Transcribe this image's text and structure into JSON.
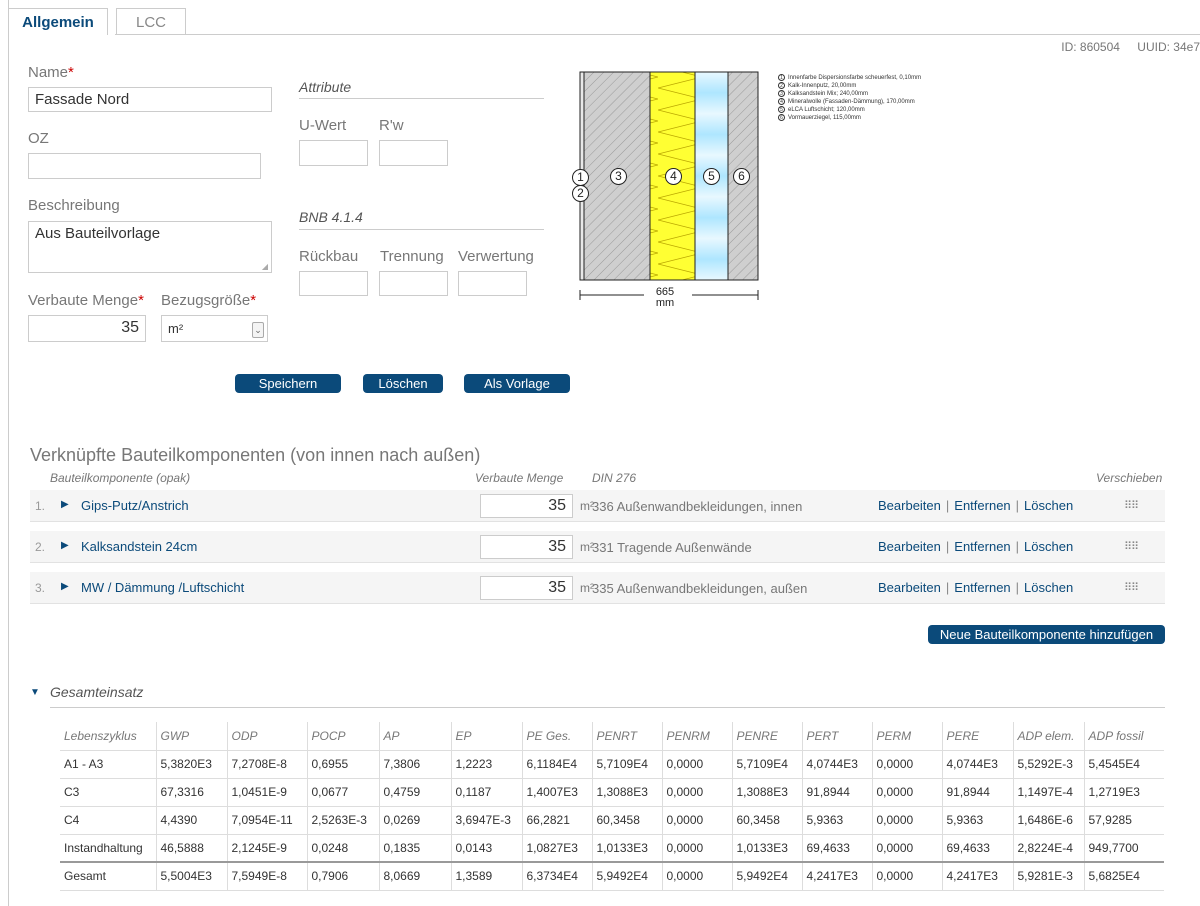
{
  "tabs": [
    {
      "label": "Allgemein"
    },
    {
      "label": "LCC"
    }
  ],
  "meta": {
    "id_text": "ID: 860504",
    "uuid_text": "UUID: 34e7"
  },
  "form": {
    "name_label": "Name",
    "name_value": "Fassade Nord",
    "oz_label": "OZ",
    "oz_value": "",
    "beschreibung_label": "Beschreibung",
    "beschreibung_value": "Aus Bauteilvorlage",
    "menge_label": "Verbaute Menge",
    "menge_value": "35",
    "bezug_label": "Bezugsgröße",
    "bezug_value": "m²",
    "required_mark": "*"
  },
  "attribute": {
    "title": "Attribute",
    "uwert_label": "U-Wert",
    "rw_label": "R'w",
    "uwert_value": "",
    "rw_value": ""
  },
  "bnb": {
    "title": "BNB 4.1.4",
    "rueckbau_label": "Rückbau",
    "trennung_label": "Trennung",
    "verwertung_label": "Verwertung"
  },
  "diagram": {
    "dimension_value": "665",
    "dimension_unit": "mm",
    "layer_numbers": [
      "1",
      "2",
      "3",
      "4",
      "5",
      "6"
    ],
    "colors": {
      "plaster": "#d0d0d0",
      "brick": "#c8c8c8",
      "insulation": "#ffff33",
      "air": "#cdeeff"
    },
    "legend": [
      "Innenfarbe Dispersionsfarbe scheuerfest, 0,10mm",
      "Kalk-Innenputz, 20,00mm",
      "Kalksandstein Mix; 240,00mm",
      "Mineralwolle (Fassaden-Dämmung), 170,00mm",
      "eLCA Luftschicht; 120,00mm",
      "Vormauerziegel, 115,00mm"
    ]
  },
  "buttons": {
    "save": "Speichern",
    "delete": "Löschen",
    "template": "Als Vorlage",
    "add_component": "Neue Bauteilkomponente hinzufügen"
  },
  "components": {
    "title": "Verknüpfte Bauteilkomponenten (von innen nach außen)",
    "col_component": "Bauteilkomponente (opak)",
    "col_qty": "Verbaute Menge",
    "col_din": "DIN 276",
    "col_move": "Verschieben",
    "action_edit": "Bearbeiten",
    "action_remove": "Entfernen",
    "action_delete": "Löschen",
    "rows": [
      {
        "idx": "1.",
        "name": "Gips-Putz/Anstrich",
        "qty": "35",
        "unit": "m²",
        "din": "336 Außenwandbekleidungen, innen"
      },
      {
        "idx": "2.",
        "name": "Kalksandstein 24cm",
        "qty": "35",
        "unit": "m²",
        "din": "331 Tragende Außenwände"
      },
      {
        "idx": "3.",
        "name": "MW / Dämmung /Luftschicht",
        "qty": "35",
        "unit": "m²",
        "din": "335 Außenwandbekleidungen, außen"
      }
    ]
  },
  "results": {
    "title": "Gesamteinsatz",
    "headers": [
      "Lebenszyklus",
      "GWP",
      "ODP",
      "POCP",
      "AP",
      "EP",
      "PE Ges.",
      "PENRT",
      "PENRM",
      "PENRE",
      "PERT",
      "PERM",
      "PERE",
      "ADP elem.",
      "ADP fossil"
    ],
    "rows": [
      [
        "A1 - A3",
        "5,3820E3",
        "7,2708E-8",
        "0,6955",
        "7,3806",
        "1,2223",
        "6,1184E4",
        "5,7109E4",
        "0,0000",
        "5,7109E4",
        "4,0744E3",
        "0,0000",
        "4,0744E3",
        "5,5292E-3",
        "5,4545E4"
      ],
      [
        "C3",
        "67,3316",
        "1,0451E-9",
        "0,0677",
        "0,4759",
        "0,1187",
        "1,4007E3",
        "1,3088E3",
        "0,0000",
        "1,3088E3",
        "91,8944",
        "0,0000",
        "91,8944",
        "1,1497E-4",
        "1,2719E3"
      ],
      [
        "C4",
        "4,4390",
        "7,0954E-11",
        "2,5263E-3",
        "0,0269",
        "3,6947E-3",
        "66,2821",
        "60,3458",
        "0,0000",
        "60,3458",
        "5,9363",
        "0,0000",
        "5,9363",
        "1,6486E-6",
        "57,9285"
      ],
      [
        "Instandhaltung",
        "46,5888",
        "2,1245E-9",
        "0,0248",
        "0,1835",
        "0,0143",
        "1,0827E3",
        "1,0133E3",
        "0,0000",
        "1,0133E3",
        "69,4633",
        "0,0000",
        "69,4633",
        "2,8224E-4",
        "949,7700"
      ],
      [
        "Gesamt",
        "5,5004E3",
        "7,5949E-8",
        "0,7906",
        "8,0669",
        "1,3589",
        "6,3734E4",
        "5,9492E4",
        "0,0000",
        "5,9492E4",
        "4,2417E3",
        "0,0000",
        "4,2417E3",
        "5,9281E-3",
        "5,6825E4"
      ]
    ]
  }
}
